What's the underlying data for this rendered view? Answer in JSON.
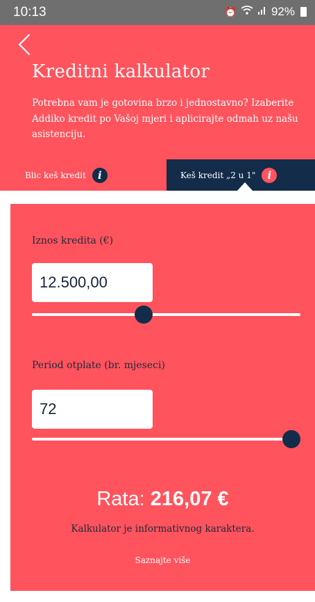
{
  "status_bar": {
    "time": "10:13",
    "battery_percent": "92%",
    "icons": [
      "alarm-icon",
      "wifi-icon",
      "signal-icon",
      "battery-icon"
    ]
  },
  "header": {
    "back_icon": "chevron-left-icon",
    "title": "Kreditni kalkulator",
    "description": "Potrebna vam je gotovina brzo i jednostavno? Izaberite Addiko kredit po Vašoj mjeri i aplicirajte odmah uz našu asistenciju."
  },
  "tabs": [
    {
      "label": "Blic keš kredit",
      "active": false,
      "icon": "info-icon"
    },
    {
      "label": "Keš kredit „2 u 1\"",
      "active": true,
      "icon": "info-icon"
    }
  ],
  "calculator": {
    "amount": {
      "label": "Iznos kredita (€)",
      "value": "12.500,00",
      "slider_position": 0.41
    },
    "period": {
      "label": "Period otplate (br. mjeseci)",
      "value": "72",
      "slider_position": 1.0
    },
    "rate": {
      "label": "Rata:",
      "value": "216,07 €"
    },
    "disclaimer": "Kalkulator je informativnog karaktera.",
    "learn_more": "Saznajte više"
  },
  "colors": {
    "brand_red": "#ff535d",
    "navy": "#132c4a",
    "status_bar": "#6f6f6f"
  }
}
